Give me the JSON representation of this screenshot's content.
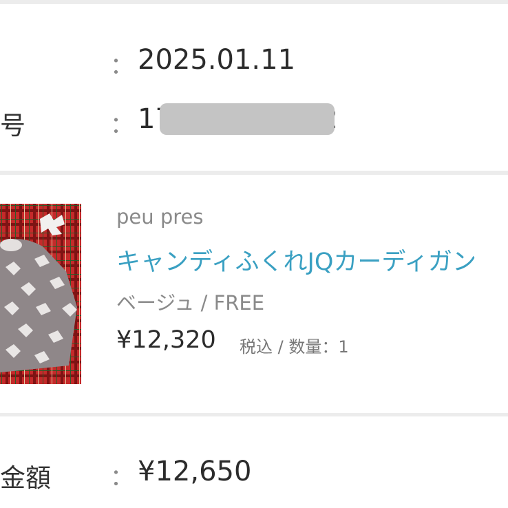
{
  "order_info": {
    "date_label": "",
    "date_colon": "：",
    "date_value": "2025.01.11",
    "number_label": "号",
    "number_colon": "：",
    "number_value_prefix": "175",
    "number_value_suffix": "62",
    "number_redacted": true
  },
  "product": {
    "brand": "peu pres",
    "name": "キャンディふくれJQカーディガン",
    "variant": "ベージュ / FREE",
    "price": "¥12,320",
    "tax_note": "税込",
    "qty_separator": "/",
    "qty_label": "数量：",
    "qty_value": "1",
    "thumbnail_icon": "product-photo",
    "link_color": "#3aa0c2"
  },
  "total": {
    "label": "金額",
    "colon": "：",
    "value": "¥12,650"
  }
}
